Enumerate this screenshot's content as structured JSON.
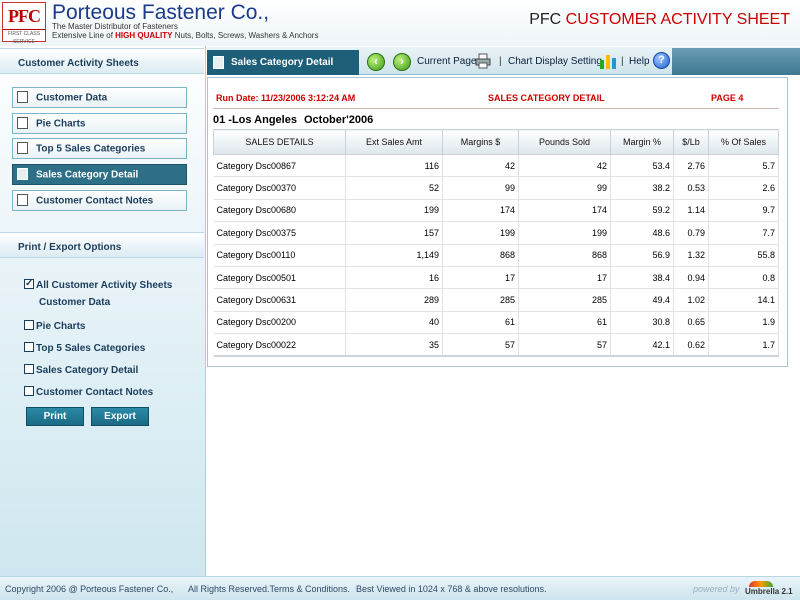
{
  "header": {
    "logo_text": "PFC",
    "logo_tag": "FIRST CLASS SERVICE",
    "company_name": "Porteous Fastener Co.,",
    "tagline": "The Master Distributor of Fasteners",
    "tagline2_prefix": "Extensive Line of ",
    "tagline2_highlight": "HIGH QUALITY",
    "tagline2_suffix": " Nuts, Bolts, Screws, Washers & Anchors",
    "title_prefix": "PFC ",
    "title_main": "CUSTOMER ACTIVITY SHEET"
  },
  "sidebar": {
    "sheets_title": "Customer Activity Sheets",
    "items": [
      {
        "label": "Customer Data"
      },
      {
        "label": "Pie Charts"
      },
      {
        "label": "Top 5 Sales Categories"
      },
      {
        "label": "Sales Category Detail"
      },
      {
        "label": "Customer Contact Notes"
      }
    ],
    "active_index": 3,
    "print_title": "Print / Export Options",
    "options": {
      "all_label": "All Customer Activity Sheets",
      "all_checked": true,
      "all_sub_label": "Customer Data",
      "pie_label": "Pie Charts",
      "top5_label": "Top 5 Sales Categories",
      "detail_label": "Sales Category Detail",
      "notes_label": "Customer Contact Notes"
    },
    "print_button": "Print",
    "export_button": "Export"
  },
  "toolbar": {
    "active_tab": "Sales Category Detail",
    "current_page": "Current Page",
    "chart_display": "Chart Display Setting",
    "help": "Help",
    "sep": "|"
  },
  "report": {
    "run_date": "Run Date: 11/23/2006 3:12:24 AM",
    "title": "SALES CATEGORY DETAIL",
    "page": "PAGE 4",
    "region": "01 -Los Angeles",
    "period": "October'2006",
    "columns": [
      "SALES DETAILS",
      "Ext Sales Amt",
      "Margins $",
      "Pounds Sold",
      "Margin %",
      "$/Lb",
      "% Of Sales"
    ],
    "rows": [
      [
        "Category Dsc00867",
        "116",
        "42",
        "42",
        "53.4",
        "2.76",
        "5.7"
      ],
      [
        "Category Dsc00370",
        "52",
        "99",
        "99",
        "38.2",
        "0.53",
        "2.6"
      ],
      [
        "Category Dsc00680",
        "199",
        "174",
        "174",
        "59.2",
        "1.14",
        "9.7"
      ],
      [
        "Category Dsc00375",
        "157",
        "199",
        "199",
        "48.6",
        "0.79",
        "7.7"
      ],
      [
        "Category Dsc00110",
        "1,149",
        "868",
        "868",
        "56.9",
        "1.32",
        "55.8"
      ],
      [
        "Category Dsc00501",
        "16",
        "17",
        "17",
        "38.4",
        "0.94",
        "0.8"
      ],
      [
        "Category Dsc00631",
        "289",
        "285",
        "285",
        "49.4",
        "1.02",
        "14.1"
      ],
      [
        "Category Dsc00200",
        "40",
        "61",
        "61",
        "30.8",
        "0.65",
        "1.9"
      ],
      [
        "Category Dsc00022",
        "35",
        "57",
        "57",
        "42.1",
        "0.62",
        "1.7"
      ]
    ]
  },
  "footer": {
    "copyright": "Copyright 2006 @ Porteous Fastener Co.,",
    "rights": "All Rights Reserved.Terms & Conditions.",
    "best_viewed": "Best Viewed in 1024 x 768 & above resolutions.",
    "powered": "powered by",
    "umbrella": "Umbrella 2.1"
  },
  "colors": {
    "accent": "#1d5f79",
    "title_red": "#cc0000",
    "brand_blue": "#1a3a8a"
  },
  "icons": [
    "document-icon",
    "back-arrow-icon",
    "forward-arrow-icon",
    "printer-icon",
    "chart-icon",
    "help-icon",
    "checkbox-icon"
  ]
}
